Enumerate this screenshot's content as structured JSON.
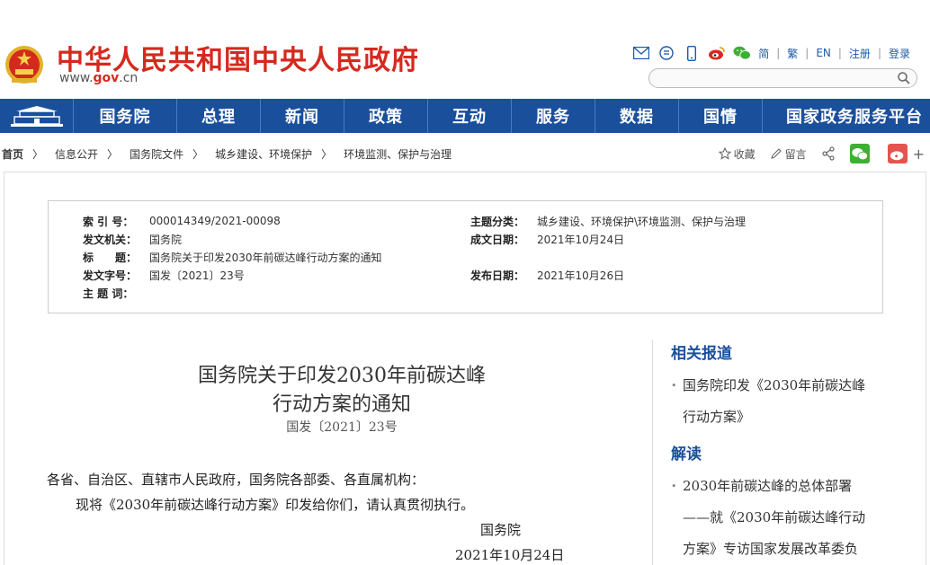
{
  "header": {
    "title": "中华人民共和国中央人民政府",
    "url_prefix": "www.",
    "url_brand": "gov",
    "url_suffix": ".cn",
    "links": [
      "简",
      "繁",
      "EN",
      "注册",
      "登录"
    ],
    "search_placeholder": ""
  },
  "nav": {
    "items": [
      "国务院",
      "总理",
      "新闻",
      "政策",
      "互动",
      "服务",
      "数据",
      "国情",
      "国家政务服务平台"
    ]
  },
  "breadcrumb": [
    "首页",
    "信息公开",
    "国务院文件",
    "城乡建设、环境保护",
    "环境监测、保护与治理"
  ],
  "share": {
    "favorite": "收藏",
    "comment": "留言"
  },
  "meta": {
    "index_label": "索 引 号：",
    "index_value": "000014349/2021-00098",
    "subject_label": "主题分类：",
    "subject_value": "城乡建设、环境保护\\环境监测、保护与治理",
    "issuer_label": "发文机关：",
    "issuer_value": "国务院",
    "date_label": "成文日期：",
    "date_value": "2021年10月24日",
    "title_label": "标　　题：",
    "title_value": "国务院关于印发2030年前碳达峰行动方案的通知",
    "docno_label": "发文字号：",
    "docno_value": "国发〔2021〕23号",
    "pub_label": "发布日期：",
    "pub_value": "2021年10月26日",
    "keywords_label": "主 题 词："
  },
  "article": {
    "title_line1": "国务院关于印发2030年前碳达峰",
    "title_line2": "行动方案的通知",
    "doc_number": "国发〔2021〕23号",
    "para1": "各省、自治区、直辖市人民政府，国务院各部委、各直属机构：",
    "para2": "现将《2030年前碳达峰行动方案》印发给你们，请认真贯彻执行。",
    "signature": "国务院",
    "sign_date": "2021年10月24日"
  },
  "sidebar": {
    "related_title": "相关报道",
    "related_line1": "国务院印发《2030年前碳达峰",
    "related_line2": "行动方案》",
    "interp_title": "解读",
    "interp_line1": "2030年前碳达峰的总体部署",
    "interp_line2": "——就《2030年前碳达峰行动",
    "interp_line3": "方案》专访国家发展改革委负"
  },
  "colors": {
    "brand_red": "#d42a1e",
    "nav_blue": "#1a4f9c",
    "wechat_green": "#3cb034",
    "weibo_red": "#e5544f"
  }
}
